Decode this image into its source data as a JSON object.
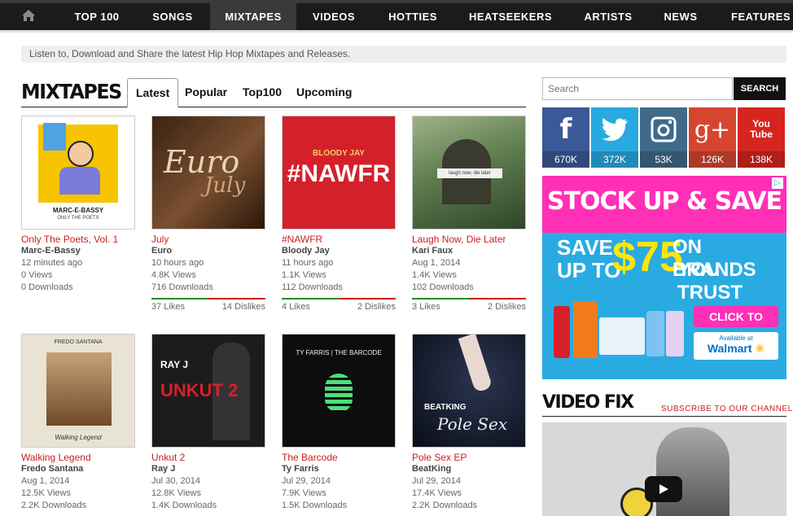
{
  "nav": {
    "items": [
      "TOP 100",
      "SONGS",
      "MIXTAPES",
      "VIDEOS",
      "HOTTIES",
      "HEATSEEKERS",
      "ARTISTS",
      "NEWS",
      "FEATURES"
    ],
    "active": "MIXTAPES",
    "home_icon": "home-icon"
  },
  "tagline": "Listen to, Download and Share the latest Hip Hop Mixtapes and Releases.",
  "section_title": "MIXTAPES",
  "tabs": [
    "Latest",
    "Popular",
    "Top100",
    "Upcoming"
  ],
  "active_tab": "Latest",
  "mixtapes": [
    {
      "title": "Only The Poets, Vol. 1",
      "artist": "Marc-E-Bassy",
      "time": "12 minutes ago",
      "views": "0 Views",
      "downloads": "0 Downloads",
      "cover": {
        "bg": "#ffffff",
        "accent": "#f6c400",
        "text": "MARC-E-BASSY",
        "sub": "ONLY THE POETS"
      }
    },
    {
      "title": "July",
      "artist": "Euro",
      "time": "10 hours ago",
      "views": "4.8K Views",
      "downloads": "716 Downloads",
      "likes": "37 Likes",
      "dislikes": "14 Dislikes",
      "cover": {
        "bg": "#5a3a22",
        "accent": "#c79a6a",
        "text": "Euro",
        "sub": "July"
      }
    },
    {
      "title": "#NAWFR",
      "artist": "Bloody Jay",
      "time": "11 hours ago",
      "views": "1.1K Views",
      "downloads": "112 Downloads",
      "likes": "4 Likes",
      "dislikes": "2 Dislikes",
      "cover": {
        "bg": "#d4202a",
        "accent": "#ffffff",
        "text": "#NAWFR",
        "sub": "BLOODY JAY"
      }
    },
    {
      "title": "Laugh Now, Die Later",
      "artist": "Kari Faux",
      "time": "Aug 1, 2014",
      "views": "1.4K Views",
      "downloads": "102 Downloads",
      "likes": "3 Likes",
      "dislikes": "2 Dislikes",
      "cover": {
        "bg": "#6f8d5f",
        "accent": "#2e4a2a",
        "text": "laugh now, die later",
        "sub": ""
      }
    },
    {
      "title": "Walking Legend",
      "artist": "Fredo Santana",
      "time": "Aug 1, 2014",
      "views": "12.5K Views",
      "downloads": "2.2K Downloads",
      "cover": {
        "bg": "#e9e3d4",
        "accent": "#8a6b45",
        "text": "FREDO SANTANA",
        "sub": "Walking Legend"
      }
    },
    {
      "title": "Unkut 2",
      "artist": "Ray J",
      "time": "Jul 30, 2014",
      "views": "12.8K Views",
      "downloads": "1.4K Downloads",
      "cover": {
        "bg": "#1c1c1c",
        "accent": "#d6202a",
        "text": "RAY J",
        "sub": "UNKUT 2"
      }
    },
    {
      "title": "The Barcode",
      "artist": "Ty Farris",
      "time": "Jul 29, 2014",
      "views": "7.9K Views",
      "downloads": "1.5K Downloads",
      "cover": {
        "bg": "#0d0d0d",
        "accent": "#4be07a",
        "text": "TY FARRIS | THE BARCODE",
        "sub": ""
      }
    },
    {
      "title": "Pole Sex EP",
      "artist": "BeatKing",
      "time": "Jul 29, 2014",
      "views": "17.4K Views",
      "downloads": "2.2K Downloads",
      "cover": {
        "bg": "#0e1420",
        "accent": "#e8d9d0",
        "text": "BEATKING",
        "sub": "Pole Sex"
      }
    }
  ],
  "search": {
    "placeholder": "Search",
    "button": "SEARCH"
  },
  "social": [
    {
      "name": "facebook-icon",
      "glyph": "f",
      "count": "670K",
      "color": "#3b5998"
    },
    {
      "name": "twitter-icon",
      "glyph": "t",
      "count": "372K",
      "color": "#28a9e0"
    },
    {
      "name": "instagram-icon",
      "glyph": "ig",
      "count": "53K",
      "color": "#3f6a8a"
    },
    {
      "name": "googleplus-icon",
      "glyph": "g+",
      "count": "126K",
      "color": "#d6452f"
    },
    {
      "name": "youtube-icon",
      "glyph": "You Tube",
      "count": "138K",
      "color": "#d6251f"
    }
  ],
  "ad": {
    "headline": "STOCK UP & SAVE",
    "line1": "SAVE",
    "line2": "UP TO",
    "amount": "$75",
    "line3": "ON BRANDS",
    "line4": "YOU TRUST",
    "cta": "CLICK TO SAVE",
    "available": "Available at",
    "retailer": "Walmart"
  },
  "video": {
    "title": "VIDEO FIX",
    "subscribe": "SUBSCRIBE TO OUR CHANNEL"
  }
}
